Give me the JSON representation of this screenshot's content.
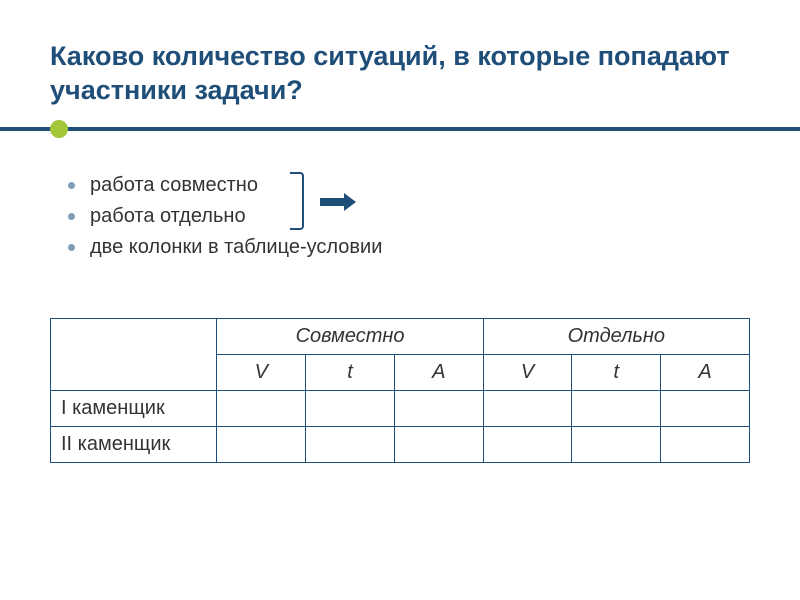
{
  "title": "Каково количество ситуаций, в которые попадают участники задачи?",
  "bullets": {
    "item1": "работа совместно",
    "item2": "работа отдельно",
    "item3": "две колонки в таблице-условии"
  },
  "table": {
    "group1": "Совместно",
    "group2": "Отдельно",
    "sub": {
      "v": "V",
      "t": "t",
      "a": "A"
    },
    "row1": "I каменщик",
    "row2": "II каменщик"
  }
}
